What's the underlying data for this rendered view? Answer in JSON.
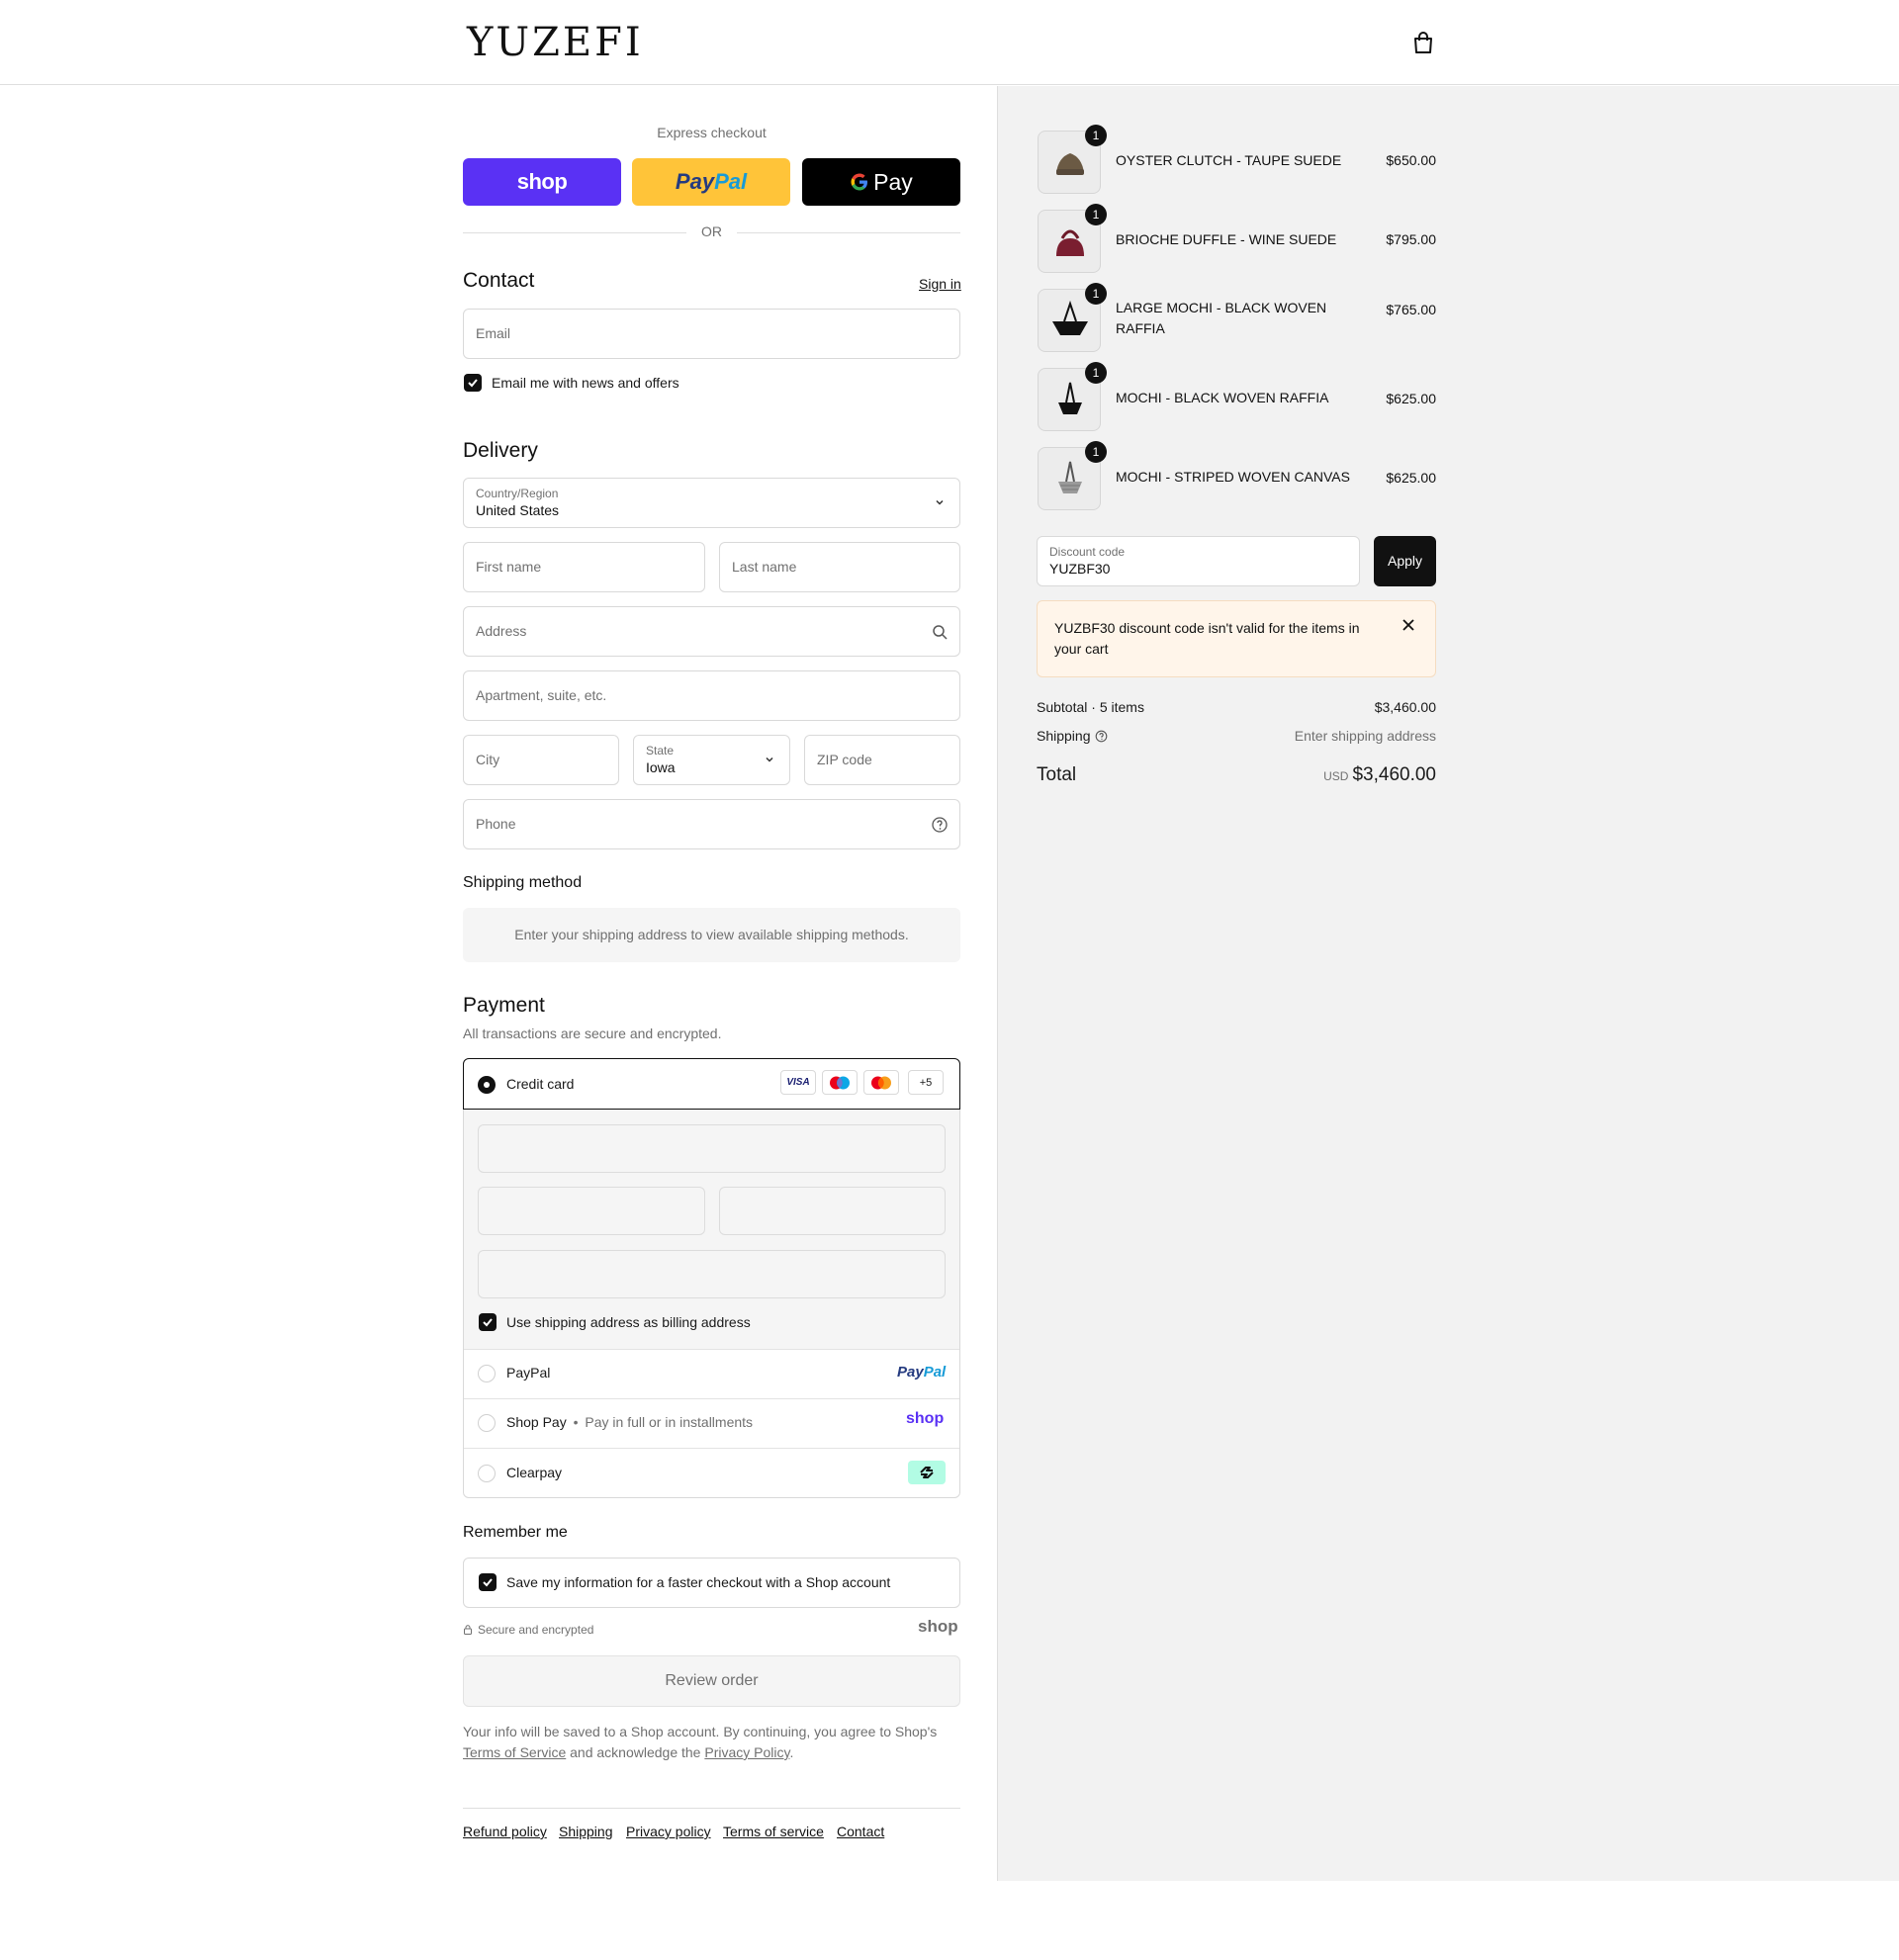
{
  "header": {
    "logo": "YUZEFI",
    "cart_icon": "shopping-bag-icon"
  },
  "express": {
    "title": "Express checkout",
    "shop_label": "shop",
    "paypal_label_a": "Pay",
    "paypal_label_b": "Pal",
    "gpay_label": "Pay",
    "or": "OR",
    "colors": {
      "shop": "#5a31f4",
      "paypal": "#ffc439",
      "gpay": "#000000"
    }
  },
  "contact": {
    "title": "Contact",
    "sign_in": "Sign in",
    "email_placeholder": "Email",
    "news_label": "Email me with news and offers",
    "news_checked": true
  },
  "delivery": {
    "title": "Delivery",
    "country_label": "Country/Region",
    "country_value": "United States",
    "first_name": "First name",
    "last_name": "Last name",
    "address": "Address",
    "apartment": "Apartment, suite, etc.",
    "city": "City",
    "state_label": "State",
    "state_value": "Iowa",
    "zip": "ZIP code",
    "phone": "Phone"
  },
  "shipping_method": {
    "title": "Shipping method",
    "message": "Enter your shipping address to view available shipping methods."
  },
  "payment": {
    "title": "Payment",
    "subtitle": "All transactions are secure and encrypted.",
    "credit_card": "Credit card",
    "card_badges": [
      "VISA",
      "maestro",
      "mastercard",
      "+5"
    ],
    "billing_same": "Use shipping address as billing address",
    "paypal": "PayPal",
    "paypal_logo_a": "Pay",
    "paypal_logo_b": "Pal",
    "shop_pay": "Shop Pay",
    "shop_pay_sep": "•",
    "shop_pay_note": "Pay in full or in installments",
    "shop_logo": "shop",
    "clearpay": "Clearpay",
    "clearpay_color": "#b2fce4"
  },
  "remember": {
    "title": "Remember me",
    "save_label": "Save my information for a faster checkout with a Shop account",
    "secure": "Secure and encrypted",
    "shop_logo": "shop"
  },
  "review_button": "Review order",
  "legal": {
    "line1": "Your info will be saved to a Shop account. By continuing, you agree to Shop's",
    "terms": "Terms of Service",
    "mid": "and acknowledge the",
    "privacy": "Privacy Policy",
    "end": "."
  },
  "footer": [
    "Refund policy",
    "Shipping",
    "Privacy policy",
    "Terms of service",
    "Contact"
  ],
  "cart": {
    "items": [
      {
        "name": "OYSTER CLUTCH - TAUPE SUEDE",
        "price": "$650.00",
        "qty": "1"
      },
      {
        "name": "BRIOCHE DUFFLE - WINE SUEDE",
        "price": "$795.00",
        "qty": "1"
      },
      {
        "name": "LARGE MOCHI - BLACK WOVEN RAFFIA",
        "price": "$765.00",
        "qty": "1"
      },
      {
        "name": "MOCHI - BLACK WOVEN RAFFIA",
        "price": "$625.00",
        "qty": "1"
      },
      {
        "name": "MOCHI - STRIPED WOVEN CANVAS",
        "price": "$625.00",
        "qty": "1"
      }
    ],
    "discount_label": "Discount code",
    "discount_value": "YUZBF30",
    "apply": "Apply",
    "error": "YUZBF30 discount code isn't valid for the items in your cart",
    "subtotal_label": "Subtotal · 5 items",
    "subtotal_value": "$3,460.00",
    "shipping_label": "Shipping",
    "shipping_value": "Enter shipping address",
    "total_label": "Total",
    "currency": "USD",
    "total_value": "$3,460.00"
  }
}
